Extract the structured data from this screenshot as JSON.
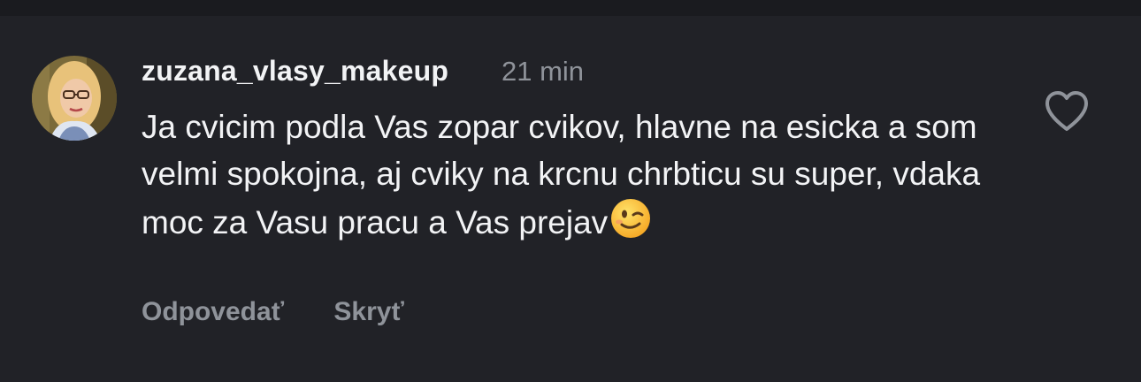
{
  "comment": {
    "username": "zuzana_vlasy_makeup",
    "time": "21 min",
    "text": "Ja cvicim podla Vas zopar cvikov, hlavne na esicka a som velmi spokojna, aj cviky na krcnu chrbticu su super, vdaka moc za Vasu pracu a Vas prejav",
    "emoji": "winking-face",
    "reply_label": "Odpovedať",
    "hide_label": "Skryť",
    "liked": false
  },
  "icons": {
    "like": "heart-outline-icon",
    "avatar": "profile-photo"
  },
  "colors": {
    "background": "#212227",
    "text": "#f2f3f5",
    "secondary": "#8f939a"
  }
}
